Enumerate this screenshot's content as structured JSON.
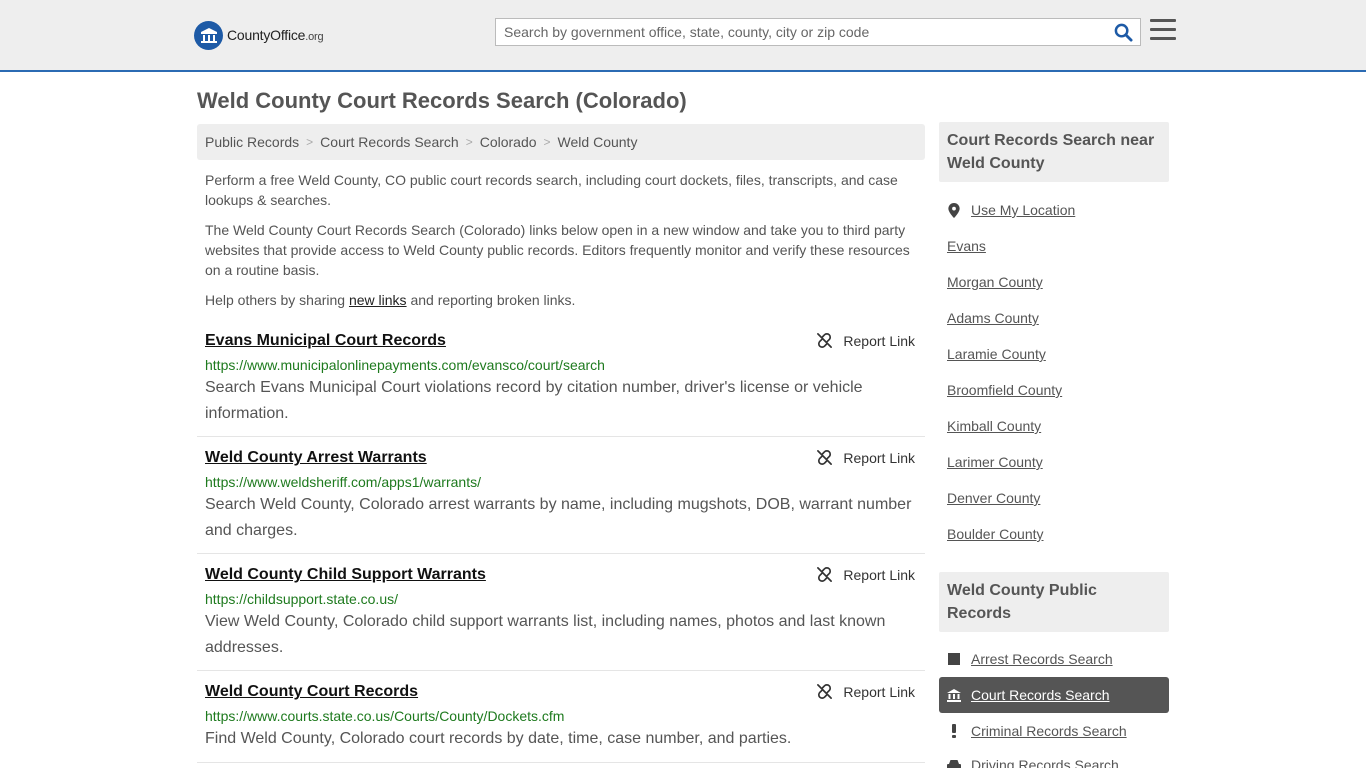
{
  "header": {
    "logo_main": "CountyOffice",
    "logo_suffix": ".org",
    "search_placeholder": "Search by government office, state, county, city or zip code"
  },
  "page": {
    "title": "Weld County Court Records Search (Colorado)"
  },
  "breadcrumb": [
    "Public Records",
    "Court Records Search",
    "Colorado",
    "Weld County"
  ],
  "intro": {
    "p1": "Perform a free Weld County, CO public court records search, including court dockets, files, transcripts, and case lookups & searches.",
    "p2": "The Weld County Court Records Search (Colorado) links below open in a new window and take you to third party websites that provide access to Weld County public records. Editors frequently monitor and verify these resources on a routine basis.",
    "p3_before": "Help others by sharing ",
    "p3_link": "new links",
    "p3_after": " and reporting broken links."
  },
  "results": [
    {
      "title": "Evans Municipal Court Records",
      "url": "https://www.municipalonlinepayments.com/evansco/court/search",
      "description": "Search Evans Municipal Court violations record by citation number, driver's license or vehicle information.",
      "report_label": "Report Link"
    },
    {
      "title": "Weld County Arrest Warrants",
      "url": "https://www.weldsheriff.com/apps1/warrants/",
      "description": "Search Weld County, Colorado arrest warrants by name, including mugshots, DOB, warrant number and charges.",
      "report_label": "Report Link"
    },
    {
      "title": "Weld County Child Support Warrants",
      "url": "https://childsupport.state.co.us/",
      "description": "View Weld County, Colorado child support warrants list, including names, photos and last known addresses.",
      "report_label": "Report Link"
    },
    {
      "title": "Weld County Court Records",
      "url": "https://www.courts.state.co.us/Courts/County/Dockets.cfm",
      "description": "Find Weld County, Colorado court records by date, time, case number, and parties.",
      "report_label": "Report Link"
    }
  ],
  "sidebar": {
    "nearby_heading": "Court Records Search near Weld County",
    "use_location": "Use My Location",
    "nearby": [
      "Evans",
      "Morgan County",
      "Adams County",
      "Laramie County",
      "Broomfield County",
      "Kimball County",
      "Larimer County",
      "Denver County",
      "Boulder County"
    ],
    "public_heading": "Weld County Public Records",
    "public_records": [
      {
        "label": "Arrest Records Search",
        "icon": "square-icon"
      },
      {
        "label": "Court Records Search",
        "icon": "courthouse-icon"
      },
      {
        "label": "Criminal Records Search",
        "icon": "exclamation-icon"
      },
      {
        "label": "Driving Records Search",
        "icon": "car-icon"
      }
    ]
  },
  "colors": {
    "accent": "#2b6bb3",
    "url_green": "#1e7a1e",
    "active_bg": "#555555"
  }
}
